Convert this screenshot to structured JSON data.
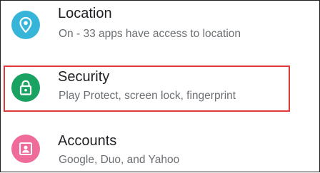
{
  "settings": {
    "items": [
      {
        "title": "Location",
        "subtitle": "On - 33 apps have access to location",
        "icon": "location-pin-icon",
        "icon_color": "#36b5d8"
      },
      {
        "title": "Security",
        "subtitle": "Play Protect, screen lock, fingerprint",
        "icon": "lock-icon",
        "icon_color": "#1aa262"
      },
      {
        "title": "Accounts",
        "subtitle": "Google, Duo, and Yahoo",
        "icon": "account-box-icon",
        "icon_color": "#ee6b9a"
      }
    ],
    "highlight_color": "#e03a3a"
  }
}
